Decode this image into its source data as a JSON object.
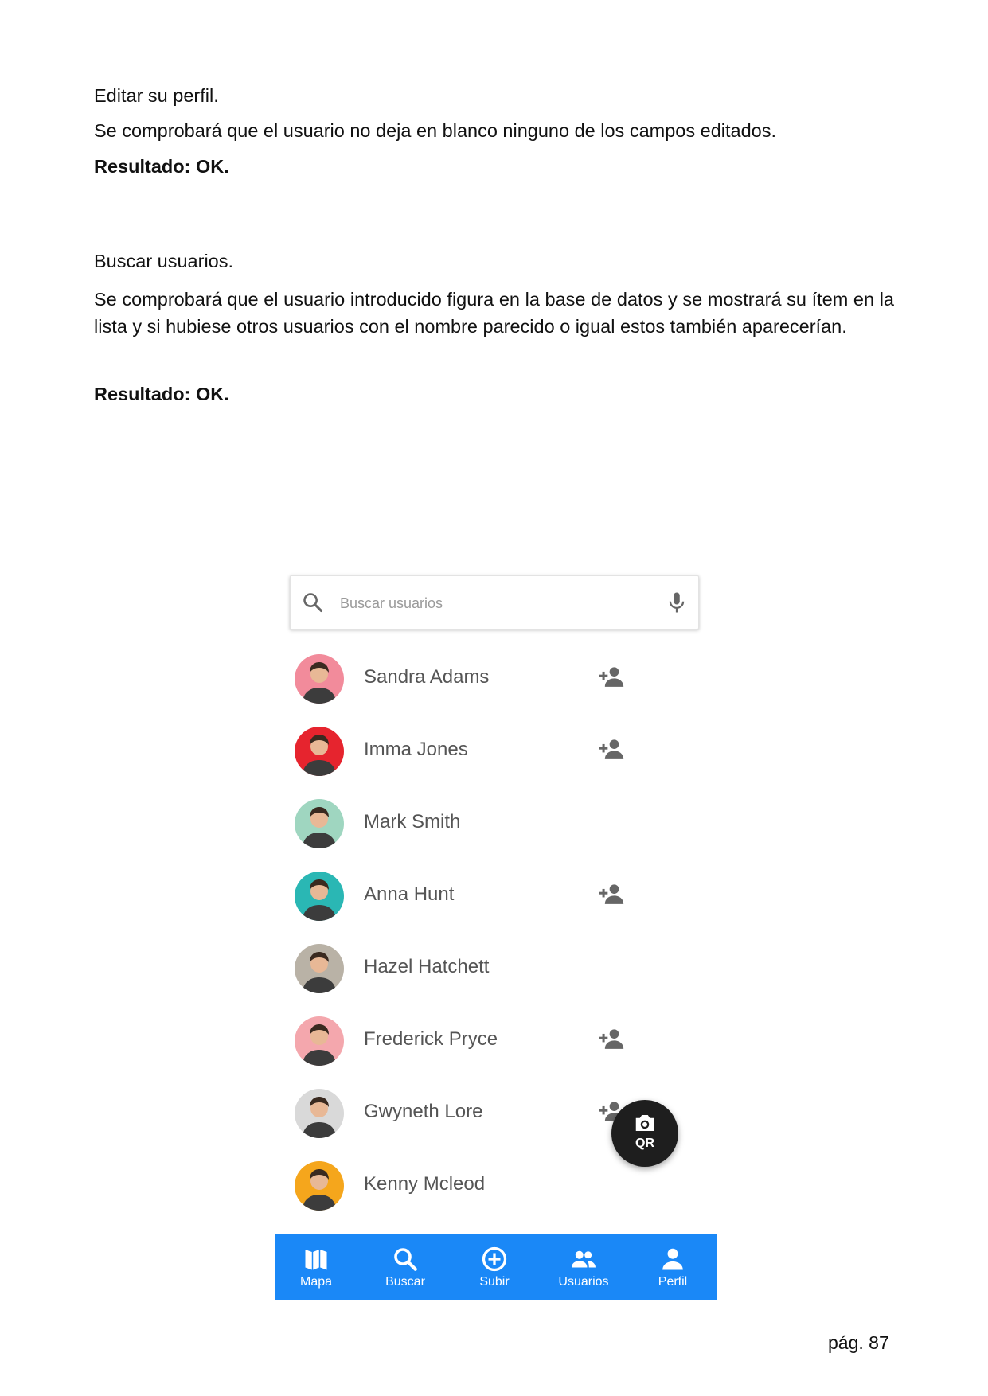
{
  "doc": {
    "section1_title": "Editar su perfil.",
    "section1_body": "Se comprobará que el usuario no deja en blanco ninguno de los campos editados.",
    "section1_result": "Resultado: OK.",
    "section2_title": "Buscar usuarios.",
    "section2_body": "Se comprobará que el usuario introducido figura en la base de datos y se mostrará su ítem en la lista y si hubiese otros usuarios con el nombre parecido o igual estos también aparecerían.",
    "section2_result": "Resultado: OK."
  },
  "app": {
    "search": {
      "placeholder": "Buscar usuarios",
      "value": ""
    },
    "users": [
      {
        "name": "Sandra Adams",
        "avatar_bg": "#f28b9b",
        "add_button": true
      },
      {
        "name": "Imma Jones",
        "avatar_bg": "#e6242e",
        "add_button": true
      },
      {
        "name": "Mark Smith",
        "avatar_bg": "#9fd6c0",
        "add_button": false
      },
      {
        "name": "Anna Hunt",
        "avatar_bg": "#2ab7b4",
        "add_button": true
      },
      {
        "name": "Hazel Hatchett",
        "avatar_bg": "#b9b2a6",
        "add_button": false
      },
      {
        "name": "Frederick Pryce",
        "avatar_bg": "#f4a7ad",
        "add_button": true
      },
      {
        "name": "Gwyneth Lore",
        "avatar_bg": "#d9d9d9",
        "add_button": true
      },
      {
        "name": "Kenny Mcleod",
        "avatar_bg": "#f5a61c",
        "add_button": false
      }
    ],
    "fab": {
      "label": "QR",
      "icon": "camera-icon"
    },
    "bottom_nav": [
      {
        "label": "Mapa",
        "icon": "map-icon"
      },
      {
        "label": "Buscar",
        "icon": "search-icon"
      },
      {
        "label": "Subir",
        "icon": "add-circle-icon"
      },
      {
        "label": "Usuarios",
        "icon": "people-icon"
      },
      {
        "label": "Perfil",
        "icon": "person-icon"
      }
    ],
    "colors": {
      "nav_bg": "#1a88f7",
      "fab_bg": "#1e1e1e",
      "text": "#555555"
    }
  },
  "page_number": "pág. 87"
}
